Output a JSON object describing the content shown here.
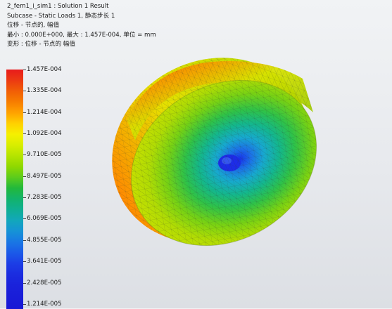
{
  "header": {
    "line1": "2_fem1_i_sim1 : Solution 1 Result",
    "line2": "Subcase - Static Loads 1, 静态步长 1",
    "line3": "位移 - 节点的, 幅值",
    "line4": "最小 : 0.000E+000, 最大 : 1.457E-004, 单位 = mm",
    "line5": "变形 : 位移 - 节点的 幅值"
  },
  "legend": {
    "labels": [
      "1.457E-004",
      "1.335E-004",
      "1.214E-004",
      "1.092E-004",
      "9.710E-005",
      "8.497E-005",
      "7.283E-005",
      "6.069E-005",
      "4.855E-005",
      "3.641E-005",
      "2.428E-005",
      "1.214E-005"
    ]
  },
  "colors": {
    "max": "#e81b1c",
    "high": "#f77d00",
    "mid_high": "#f6f000",
    "mid": "#5ccc1c",
    "mid_low": "#12a7bb",
    "min": "#1818d5"
  },
  "viewport": {
    "icon": "deformed-wheel-contour-model"
  }
}
